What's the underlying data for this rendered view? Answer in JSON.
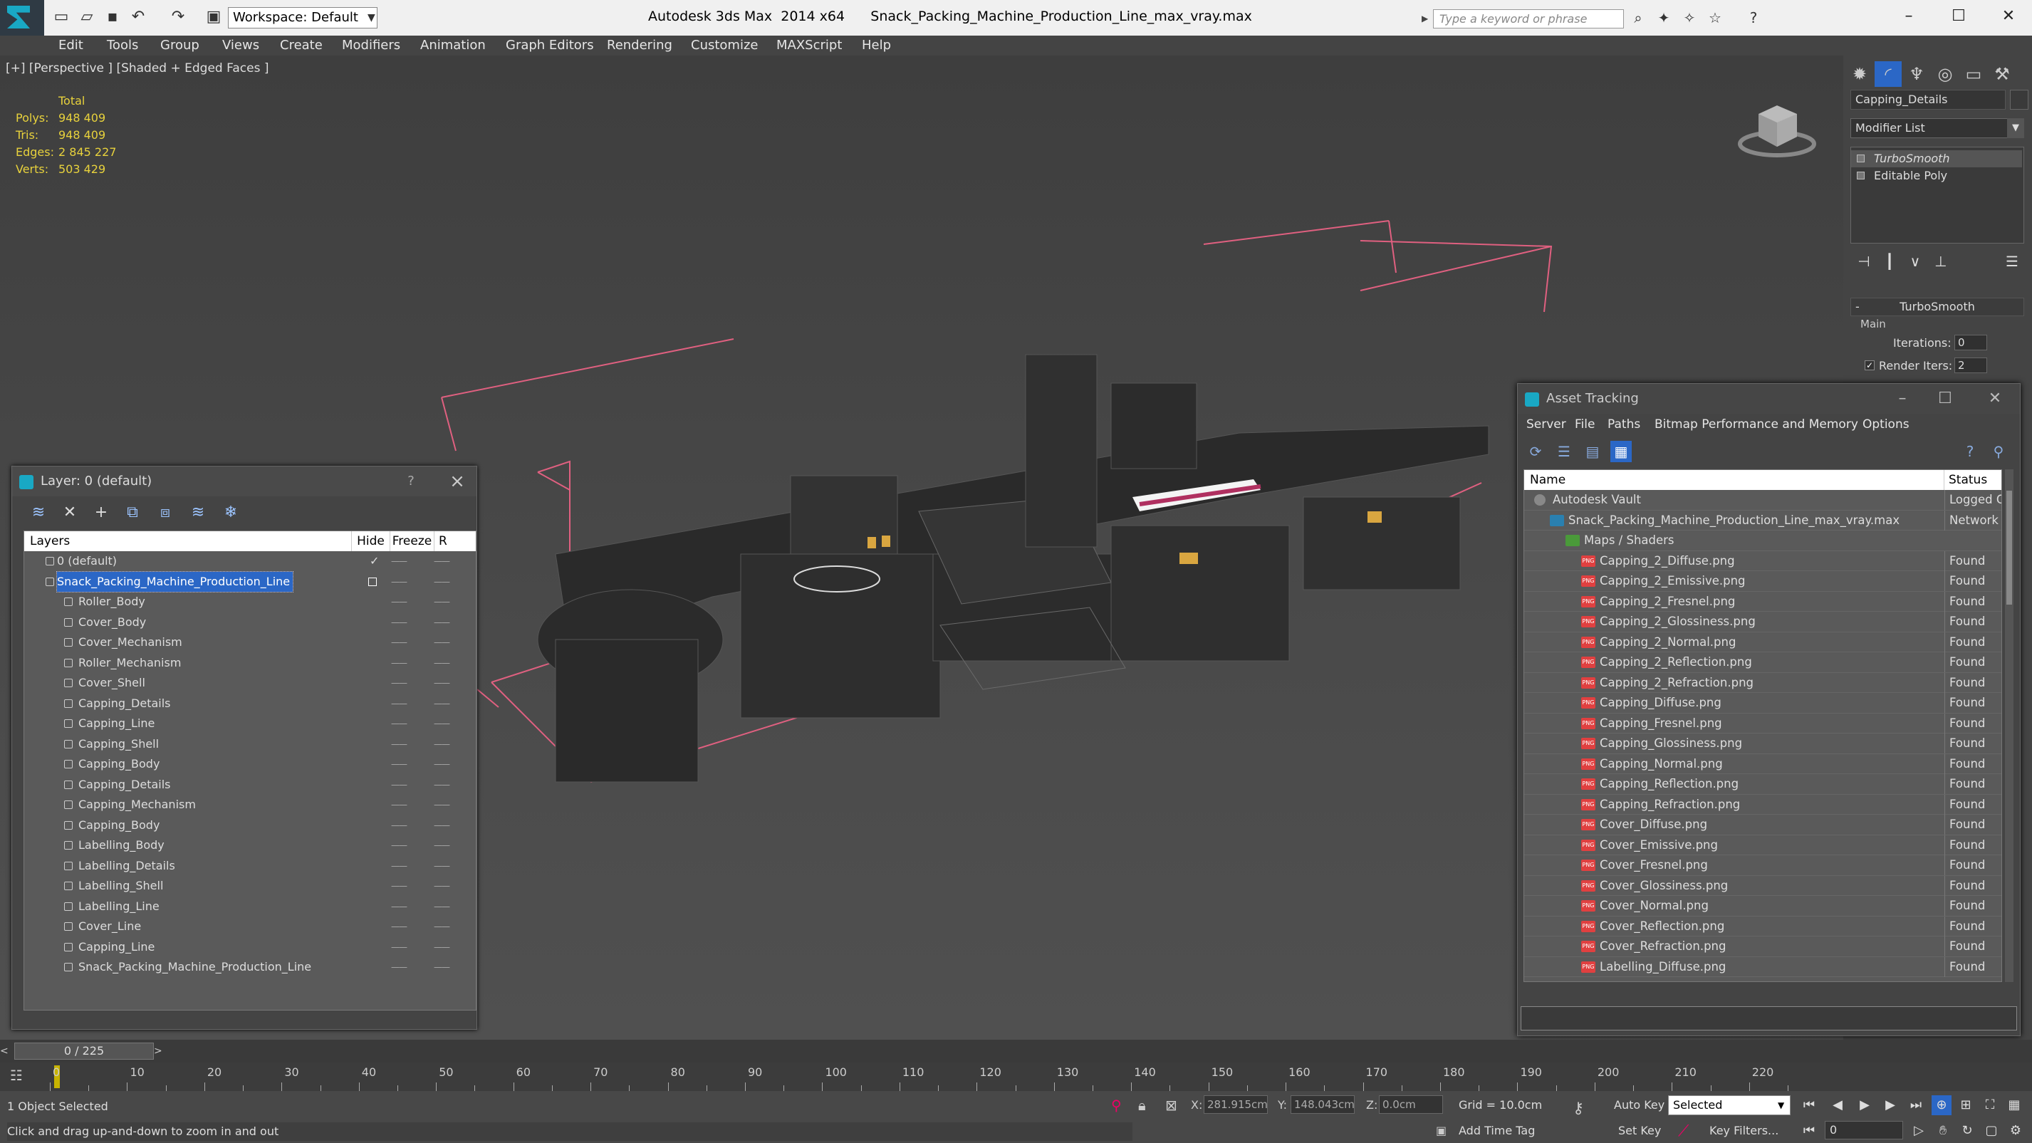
{
  "titlebar": {
    "workspace": "Workspace: Default",
    "title": "Autodesk 3ds Max  2014 x64      Snack_Packing_Machine_Production_Line_max_vray.max",
    "search_placeholder": "Type a keyword or phrase"
  },
  "menu": [
    "Edit",
    "Tools",
    "Group",
    "Views",
    "Create",
    "Modifiers",
    "Animation",
    "Graph Editors",
    "Rendering",
    "Customize",
    "MAXScript",
    "Help"
  ],
  "viewport": {
    "label": "[+] [Perspective ] [Shaded + Edged Faces ]",
    "stats": {
      "header": "Total",
      "polys_label": "Polys:",
      "polys": "948 409",
      "tris_label": "Tris:",
      "tris": "948 409",
      "edges_label": "Edges:",
      "edges": "2 845 227",
      "verts_label": "Verts:",
      "verts": "503 429"
    }
  },
  "command_panel": {
    "object_name": "Capping_Details",
    "modifier_list": "Modifier List",
    "stack": [
      "TurboSmooth",
      "Editable Poly"
    ],
    "rollout": "TurboSmooth",
    "main": "Main",
    "iterations_label": "Iterations:",
    "iterations": "0",
    "render_iters_label": "Render Iters:",
    "render_iters": "2"
  },
  "layer_dialog": {
    "title": "Layer: 0 (default)",
    "help": "?",
    "col_layers": "Layers",
    "col_hide": "Hide",
    "col_freeze": "Freeze",
    "col_r": "R",
    "rows": [
      {
        "name": "0 (default)",
        "level": 0
      },
      {
        "name": "Snack_Packing_Machine_Production_Line",
        "level": 0,
        "selected": true
      },
      {
        "name": "Roller_Body",
        "level": 1
      },
      {
        "name": "Cover_Body",
        "level": 1
      },
      {
        "name": "Cover_Mechanism",
        "level": 1
      },
      {
        "name": "Roller_Mechanism",
        "level": 1
      },
      {
        "name": "Cover_Shell",
        "level": 1
      },
      {
        "name": "Capping_Details",
        "level": 1
      },
      {
        "name": "Capping_Line",
        "level": 1
      },
      {
        "name": "Capping_Shell",
        "level": 1
      },
      {
        "name": "Capping_Body",
        "level": 1
      },
      {
        "name": "Capping_Details",
        "level": 1
      },
      {
        "name": "Capping_Mechanism",
        "level": 1
      },
      {
        "name": "Capping_Body",
        "level": 1
      },
      {
        "name": "Labelling_Body",
        "level": 1
      },
      {
        "name": "Labelling_Details",
        "level": 1
      },
      {
        "name": "Labelling_Shell",
        "level": 1
      },
      {
        "name": "Labelling_Line",
        "level": 1
      },
      {
        "name": "Cover_Line",
        "level": 1
      },
      {
        "name": "Capping_Line",
        "level": 1
      },
      {
        "name": "Snack_Packing_Machine_Production_Line",
        "level": 1
      }
    ]
  },
  "asset_dialog": {
    "title": "Asset Tracking",
    "menu": [
      "Server",
      "File",
      "Paths",
      "Bitmap Performance and Memory",
      "Options"
    ],
    "col_name": "Name",
    "col_status": "Status",
    "rows": [
      {
        "name": "Autodesk Vault",
        "status": "Logged Out",
        "level": 0,
        "icon": "vault"
      },
      {
        "name": "Snack_Packing_Machine_Production_Line_max_vray.max",
        "status": "Network",
        "level": 1,
        "icon": "max"
      },
      {
        "name": "Maps / Shaders",
        "status": "",
        "level": 2,
        "icon": "maps"
      },
      {
        "name": "Capping_2_Diffuse.png",
        "status": "Found",
        "level": 3
      },
      {
        "name": "Capping_2_Emissive.png",
        "status": "Found",
        "level": 3
      },
      {
        "name": "Capping_2_Fresnel.png",
        "status": "Found",
        "level": 3
      },
      {
        "name": "Capping_2_Glossiness.png",
        "status": "Found",
        "level": 3
      },
      {
        "name": "Capping_2_Normal.png",
        "status": "Found",
        "level": 3
      },
      {
        "name": "Capping_2_Reflection.png",
        "status": "Found",
        "level": 3
      },
      {
        "name": "Capping_2_Refraction.png",
        "status": "Found",
        "level": 3
      },
      {
        "name": "Capping_Diffuse.png",
        "status": "Found",
        "level": 3
      },
      {
        "name": "Capping_Fresnel.png",
        "status": "Found",
        "level": 3
      },
      {
        "name": "Capping_Glossiness.png",
        "status": "Found",
        "level": 3
      },
      {
        "name": "Capping_Normal.png",
        "status": "Found",
        "level": 3
      },
      {
        "name": "Capping_Reflection.png",
        "status": "Found",
        "level": 3
      },
      {
        "name": "Capping_Refraction.png",
        "status": "Found",
        "level": 3
      },
      {
        "name": "Cover_Diffuse.png",
        "status": "Found",
        "level": 3
      },
      {
        "name": "Cover_Emissive.png",
        "status": "Found",
        "level": 3
      },
      {
        "name": "Cover_Fresnel.png",
        "status": "Found",
        "level": 3
      },
      {
        "name": "Cover_Glossiness.png",
        "status": "Found",
        "level": 3
      },
      {
        "name": "Cover_Normal.png",
        "status": "Found",
        "level": 3
      },
      {
        "name": "Cover_Reflection.png",
        "status": "Found",
        "level": 3
      },
      {
        "name": "Cover_Refraction.png",
        "status": "Found",
        "level": 3
      },
      {
        "name": "Labelling_Diffuse.png",
        "status": "Found",
        "level": 3
      }
    ]
  },
  "timeline": {
    "position": "0 / 225",
    "ticks": [
      "0",
      "10",
      "20",
      "30",
      "40",
      "50",
      "60",
      "70",
      "80",
      "90",
      "100",
      "110",
      "120",
      "130",
      "140",
      "150",
      "160",
      "170",
      "180",
      "190",
      "200",
      "210",
      "220"
    ]
  },
  "status": {
    "selection": "1 Object Selected",
    "prompt": "Click and drag up-and-down to zoom in and out",
    "x_label": "X:",
    "x": "281.915cm",
    "y_label": "Y:",
    "y": "148.043cm",
    "z_label": "Z:",
    "z": "0.0cm",
    "grid": "Grid = 10.0cm",
    "add_time_tag": "Add Time Tag",
    "auto_key": "Auto Key",
    "set_key": "Set Key",
    "selected": "Selected",
    "key_filters": "Key Filters...",
    "frame": "0"
  }
}
